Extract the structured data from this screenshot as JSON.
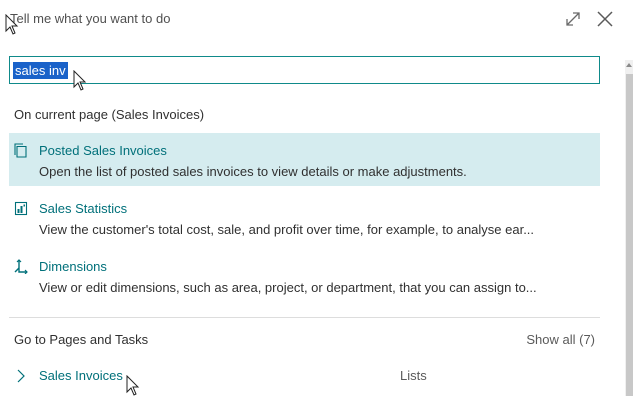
{
  "header": {
    "title": "Tell me what you want to do"
  },
  "search": {
    "value": "sales inv"
  },
  "current_page_section": {
    "heading": "On current page (Sales Invoices)",
    "results": [
      {
        "icon": "document-icon",
        "title": "Posted Sales Invoices",
        "description": "Open the list of posted sales invoices to view details or make adjustments.",
        "selected": true
      },
      {
        "icon": "report-icon",
        "title": "Sales Statistics",
        "description": "View the customer's total cost, sale, and profit over time, for example, to analyse ear...",
        "selected": false
      },
      {
        "icon": "dimensions-icon",
        "title": "Dimensions",
        "description": "View or edit dimensions, such as area, project, or department, that you can assign to...",
        "selected": false
      }
    ]
  },
  "pages_section": {
    "heading": "Go to Pages and Tasks",
    "show_all": "Show all (7)",
    "items": [
      {
        "title": "Sales Invoices",
        "category": "Lists"
      }
    ]
  },
  "colors": {
    "accent_link": "#00707a",
    "selected_row": "#d5ecef",
    "search_border": "#0f8a8a",
    "selection_highlight": "#1a62c9"
  }
}
